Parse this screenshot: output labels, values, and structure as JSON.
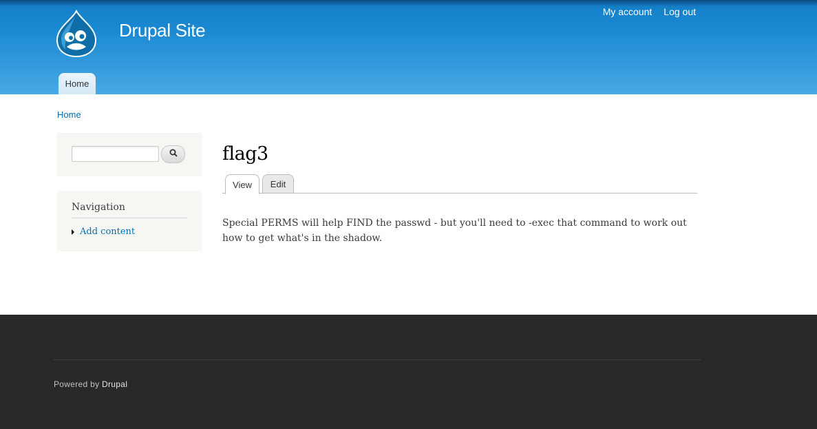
{
  "header": {
    "site_name": "Drupal Site",
    "logo_icon": "drupal-drop-logo",
    "secondary_menu": [
      "My account",
      "Log out"
    ],
    "main_menu": [
      "Home"
    ]
  },
  "breadcrumb": "Home",
  "sidebar": {
    "search": {
      "placeholder": "",
      "button_icon": "search-icon"
    },
    "navigation": {
      "title": "Navigation",
      "items": [
        "Add content"
      ]
    }
  },
  "content": {
    "title": "flag3",
    "tabs": [
      "View",
      "Edit"
    ],
    "active_tab": "View",
    "body": "Special PERMS will help FIND the passwd - but you'll need to -exec that command to work out how to get what's in the shadow."
  },
  "footer": {
    "powered_prefix": "Powered by ",
    "powered_link": "Drupal"
  },
  "colors": {
    "header_blue": "#1b8ad3",
    "link": "#0071b3",
    "footer_bg": "#292929",
    "sidebar_bg": "#f6f6f2"
  }
}
